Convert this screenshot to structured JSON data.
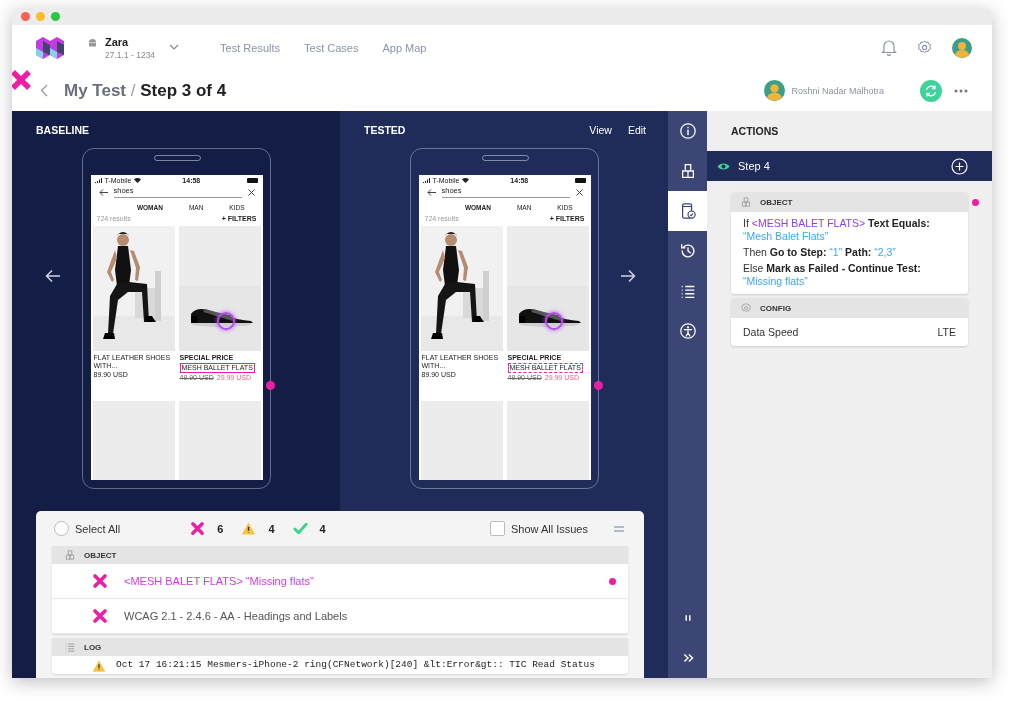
{
  "app": {
    "name": "Zara",
    "version": "27.1.1 - 1234"
  },
  "nav": [
    {
      "label": "Test Results"
    },
    {
      "label": "Test Cases"
    },
    {
      "label": "App Map"
    }
  ],
  "breadcrumb": {
    "parent": "My Test",
    "separator": "/",
    "current": "Step 3 of 4"
  },
  "user": {
    "name": "Roshni Nadar Malhotra"
  },
  "columns": [
    {
      "title": "BASELINE",
      "dashed": false,
      "phone": {
        "carrier": "T-Mobile",
        "time": "14:58",
        "search": "shoes",
        "tabs": [
          {
            "label": "WOMAN",
            "selected": true
          },
          {
            "label": "MAN",
            "selected": false
          },
          {
            "label": "KIDS",
            "selected": false
          }
        ],
        "results": "724 results",
        "filters": "+ FILTERS",
        "products": [
          {
            "kind": "person",
            "name": "FLAT LEATHER SHOES WITH...",
            "price": "89.90 USD"
          },
          {
            "kind": "shoe",
            "tag": "SPECIAL PRICE",
            "name": "MESH BALLET FLATS",
            "old_price": "49.90 USD",
            "price": "29.99 USD"
          }
        ]
      }
    },
    {
      "title": "TESTED",
      "dashed": true,
      "actions": [
        "View",
        "Edit"
      ],
      "phone": {
        "carrier": "T-Mobile",
        "time": "14:58",
        "search": "shoes",
        "tabs": [
          {
            "label": "WOMAN",
            "selected": true
          },
          {
            "label": "MAN",
            "selected": false
          },
          {
            "label": "KIDS",
            "selected": false
          }
        ],
        "results": "724 results",
        "filters": "+ FILTERS",
        "products": [
          {
            "kind": "person",
            "name": "FLAT LEATHER SHOES WITH...",
            "price": "89.90 USD"
          },
          {
            "kind": "shoe",
            "tag": "SPECIAL PRICE",
            "name": "MESH BALLET FLATS",
            "old_price": "49.90 USD",
            "price": "29.99 USD"
          }
        ]
      }
    }
  ],
  "rail": {
    "top": [
      {
        "kind": "info",
        "selected": false
      },
      {
        "kind": "cubes",
        "selected": false
      },
      {
        "kind": "phone-check",
        "selected": true
      },
      {
        "kind": "history",
        "selected": false
      },
      {
        "kind": "list",
        "selected": false
      },
      {
        "kind": "accessibility",
        "selected": false
      }
    ],
    "bottom": [
      {
        "kind": "pause",
        "selected": false
      },
      {
        "kind": "forward",
        "selected": false
      }
    ]
  },
  "actions": {
    "title": "ACTIONS",
    "step": "Step 4",
    "cards": [
      {
        "kind": "object",
        "title": "OBJECT",
        "flagged": true,
        "lines": [
          [
            {
              "kind": "plain",
              "text": "If "
            },
            {
              "kind": "element",
              "text": "<MESH BALET FLATS>"
            },
            {
              "kind": "bold",
              "text": " Text Equals: "
            },
            {
              "kind": "value",
              "text": "“Mesh Balet Flats”"
            }
          ],
          [
            {
              "kind": "plain",
              "text": "Then "
            },
            {
              "kind": "bold",
              "text": "Go to Step: "
            },
            {
              "kind": "value",
              "text": "“1” "
            },
            {
              "kind": "bold",
              "text": "Path: "
            },
            {
              "kind": "value",
              "text": "“2,3”"
            }
          ],
          [
            {
              "kind": "plain",
              "text": "Else "
            },
            {
              "kind": "bold",
              "text": "Mark as Failed - Continue Test: "
            },
            {
              "kind": "value",
              "text": "“Missing flats”"
            }
          ]
        ]
      },
      {
        "kind": "config",
        "title": "CONFIG",
        "flagged": false,
        "rows": [
          {
            "label": "Data Speed",
            "value": "LTE"
          }
        ]
      }
    ]
  },
  "issues": {
    "select_all": {
      "label": "Select All",
      "checked": false
    },
    "counts": [
      {
        "kind": "error",
        "count": "6"
      },
      {
        "kind": "warning",
        "count": "4"
      },
      {
        "kind": "pass",
        "count": "4"
      }
    ],
    "show_all": {
      "label": "Show All Issues",
      "checked": false
    },
    "sections": [
      {
        "kind": "object",
        "title": "OBJECT",
        "items": [
          {
            "kind": "error",
            "text": "<MESH BALET FLATS> “Missing flats”",
            "highlighted": true
          },
          {
            "kind": "error",
            "text": "WCAG 2.1 - 2.4.6 - AA - Headings and Labels",
            "highlighted": false
          }
        ]
      },
      {
        "kind": "log",
        "title": "LOG",
        "items": [
          {
            "kind": "warning",
            "text": "Oct 17 16:21:15 Mesmers-iPhone-2 ring(CFNetwork)[240] &lt:Error&gt:: TIC Read Status",
            "highlighted": false
          }
        ]
      }
    ]
  }
}
